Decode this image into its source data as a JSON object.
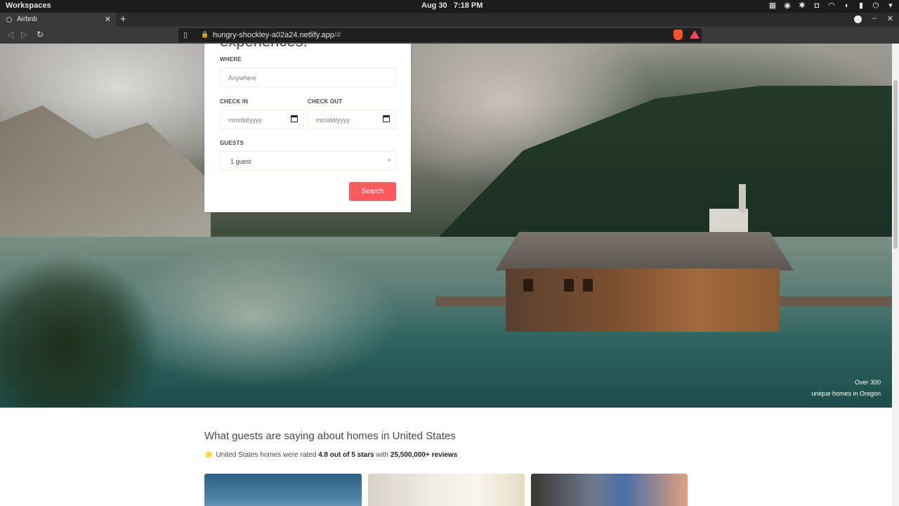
{
  "system": {
    "workspaces_label": "Workspaces",
    "date": "Aug 30",
    "time": "7:18 PM"
  },
  "browser": {
    "tab_title": "Airbnb",
    "url_host": "hungry-shockley-a02a24.netlify.app",
    "url_path": "/#"
  },
  "search_card": {
    "heading": "experiences.",
    "where_label": "WHERE",
    "where_placeholder": "Anywhere",
    "checkin_label": "CHECK IN",
    "checkin_placeholder": "mm/dd/yyyy",
    "checkout_label": "CHECK OUT",
    "checkout_placeholder": "mm/dd/yyyy",
    "guests_label": "GUESTS",
    "guests_value": "1 guest",
    "search_label": "Search"
  },
  "hero": {
    "caption_line1": "Over 300",
    "caption_line2": "unique homes in Oregon"
  },
  "reviews": {
    "title": "What guests are saying about homes in United States",
    "star": "🌟",
    "text_prefix": "United States homes were rated ",
    "rating": "4.8 out of 5 stars",
    "text_mid": " with ",
    "count": "25,500,000+ reviews"
  }
}
